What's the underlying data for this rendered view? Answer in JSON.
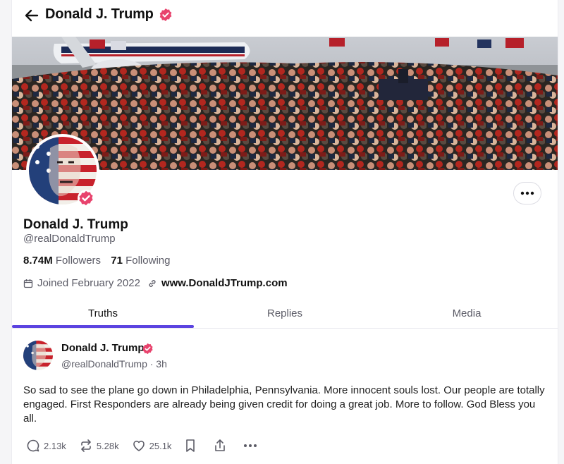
{
  "header": {
    "title": "Donald J. Trump",
    "back_icon": "arrow-left-icon"
  },
  "profile": {
    "display_name": "Donald J. Trump",
    "handle": "@realDonaldTrump",
    "followers_count": "8.74M",
    "followers_label": "Followers",
    "following_count": "71",
    "following_label": "Following",
    "joined": "Joined February 2022",
    "website": "www.DonaldJTrump.com",
    "verified_color": "#e8436d"
  },
  "tabs": [
    {
      "label": "Truths",
      "active": true
    },
    {
      "label": "Replies",
      "active": false
    },
    {
      "label": "Media",
      "active": false
    }
  ],
  "accent_color": "#5b43e0",
  "post": {
    "author": "Donald J. Trump",
    "handle_time": "@realDonaldTrump · 3h",
    "text": "So sad to see the plane go down in Philadelphia, Pennsylvania. More innocent souls lost. Our people are totally engaged. First Responders are already being given credit for doing a great job. More to follow. God Bless you all.",
    "replies": "2.13k",
    "retruths": "5.28k",
    "likes": "25.1k"
  }
}
